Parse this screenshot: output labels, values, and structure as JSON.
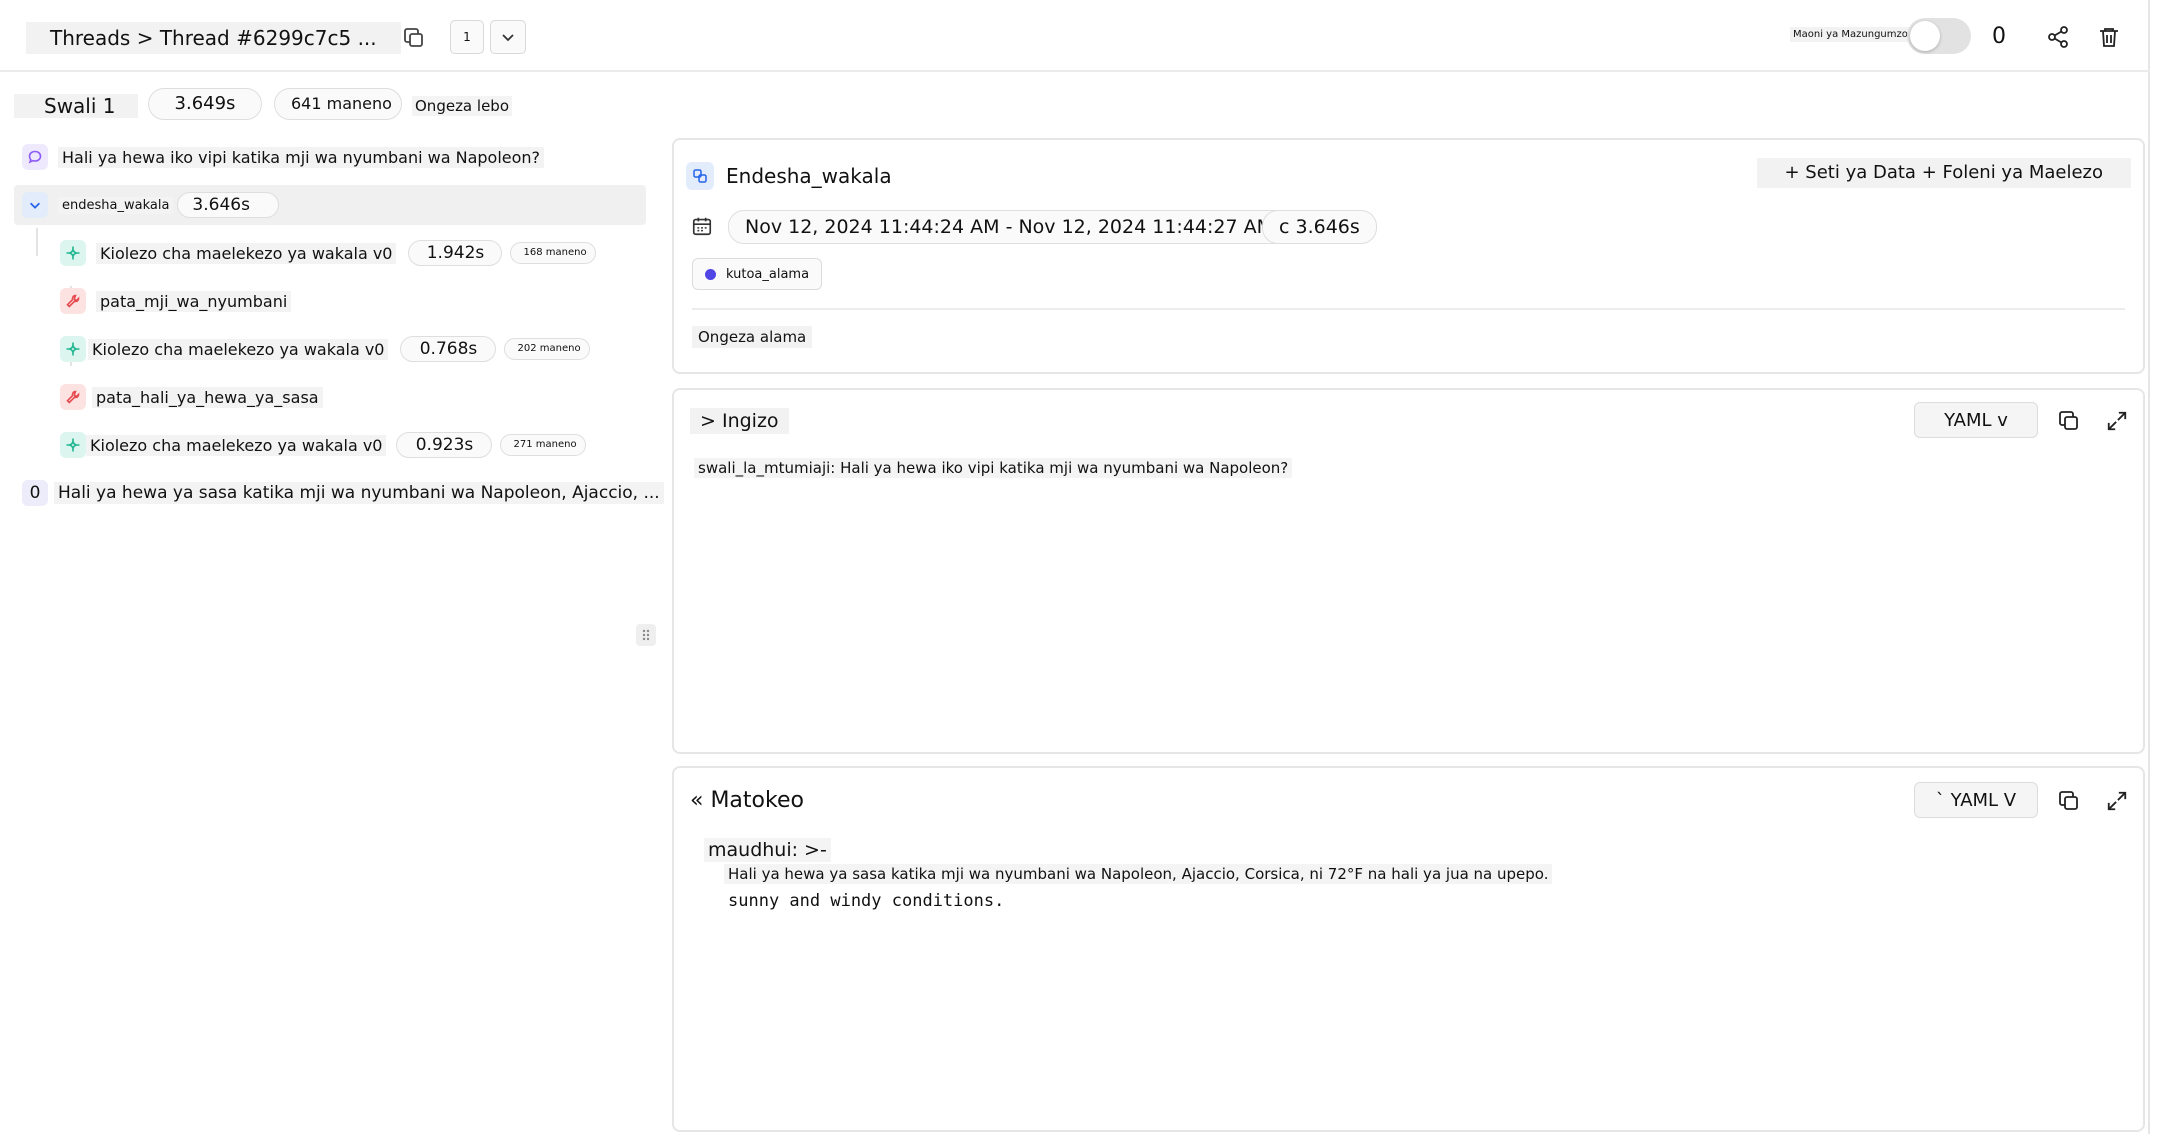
{
  "header": {
    "breadcrumb": "Threads > Thread #6299c7c5 ...",
    "page_number": "1",
    "toggle_label": "Maoni ya Mazungumzo",
    "count": "0"
  },
  "summary": {
    "title": "Swali 1",
    "duration": "3.649s",
    "tokens": "641 maneno",
    "add_tag": "Ongeza lebo"
  },
  "tree": {
    "user_message": "Hali ya hewa iko vipi katika mji wa nyumbani wa Napoleon?",
    "agent": {
      "label": "endesha_wakala",
      "duration": "3.646s"
    },
    "children": [
      {
        "type": "llm",
        "label": "Kiolezo cha maelekezo ya wakala v0",
        "duration": "1.942s",
        "tokens": "168 maneno"
      },
      {
        "type": "tool",
        "label": "pata_mji_wa_nyumbani"
      },
      {
        "type": "llm",
        "label": "Kiolezo cha maelekezo ya wakala v0",
        "duration": "0.768s",
        "tokens": "202 maneno"
      },
      {
        "type": "tool",
        "label": "pata_hali_ya_hewa_ya_sasa"
      },
      {
        "type": "llm",
        "label": "Kiolezo cha maelekezo ya wakala v0",
        "duration": "0.923s",
        "tokens": "271 maneno"
      }
    ],
    "output_index": "0",
    "output_message": "Hali ya hewa ya sasa katika mji wa nyumbani wa Napoleon, Ajaccio, ..."
  },
  "detail": {
    "title": "Endesha_wakala",
    "dataset_button": "+ Seti ya Data + Foleni ya Maelezo",
    "time_range": "Nov 12, 2024 11:44:24 AM - Nov 12, 2024 11:44:27 AM",
    "duration": "c 3.646s",
    "tag": "kutoa_alama",
    "add_score": "Ongeza alama"
  },
  "input": {
    "title": "> Ingizo",
    "format": "YAML v",
    "content": "swali_la_mtumiaji: Hali ya hewa iko vipi katika mji wa nyumbani wa Napoleon?"
  },
  "output": {
    "title": "« Matokeo",
    "format": "` YAML V",
    "key": "maudhui: >-",
    "line1": "Hali ya hewa ya sasa katika mji wa nyumbani wa Napoleon, Ajaccio, Corsica, ni 72°F na hali ya jua na upepo.",
    "line2": "sunny and windy conditions."
  },
  "colors": {
    "llm_icon": "#1fb58f",
    "tool_icon": "#e5484d",
    "message_icon": "#8b5cf6",
    "chevron": "#2563eb",
    "tag_dot": "#4f46e5"
  },
  "icons": [
    "copy-icon",
    "chevron-down-icon",
    "share-icon",
    "trash-icon",
    "message-icon",
    "sparkle-icon",
    "wrench-icon",
    "calendar-icon",
    "link-icon",
    "expand-icon",
    "grip-icon"
  ]
}
